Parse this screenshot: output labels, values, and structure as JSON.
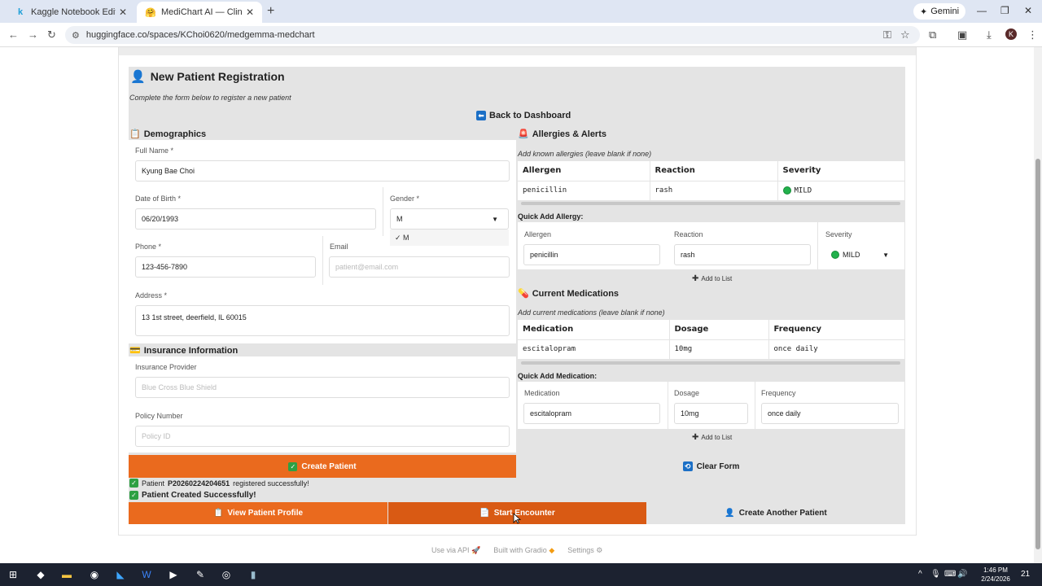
{
  "browser": {
    "tabs": [
      {
        "favicon": "k",
        "title": "Kaggle Notebook Editor"
      },
      {
        "favicon": "hf",
        "title": "MediChart AI — Clinical EHR po"
      }
    ],
    "gemini_label": "Gemini",
    "url": "huggingface.co/spaces/KChoi0620/medgemma-medchart",
    "profile_initial": "K"
  },
  "page": {
    "title": "New Patient Registration",
    "subtitle": "Complete the form below to register a new patient",
    "back_label": "Back to Dashboard"
  },
  "demographics": {
    "title": "Demographics",
    "full_name_label": "Full Name *",
    "full_name_value": "Kyung Bae Choi",
    "dob_label": "Date of Birth *",
    "dob_value": "06/20/1993",
    "gender_label": "Gender *",
    "gender_value": "M",
    "gender_option": "✓ M",
    "phone_label": "Phone *",
    "phone_value": "123-456-7890",
    "email_label": "Email",
    "email_placeholder": "patient@email.com",
    "address_label": "Address *",
    "address_value": "13 1st street, deerfield, IL 60015"
  },
  "insurance": {
    "title": "Insurance Information",
    "provider_label": "Insurance Provider",
    "provider_placeholder": "Blue Cross Blue Shield",
    "policy_label": "Policy Number",
    "policy_placeholder": "Policy ID"
  },
  "allergies": {
    "title": "Allergies & Alerts",
    "subtitle": "Add known allergies (leave blank if none)",
    "columns": [
      "Allergen",
      "Reaction",
      "Severity"
    ],
    "rows": [
      {
        "allergen": "penicillin",
        "reaction": "rash",
        "severity": "MILD"
      }
    ],
    "quick_title": "Quick Add Allergy:",
    "quick_allergen_label": "Allergen",
    "quick_allergen_value": "penicillin",
    "quick_reaction_label": "Reaction",
    "quick_reaction_value": "rash",
    "quick_severity_label": "Severity",
    "quick_severity_value": "MILD",
    "add_label": "Add to List"
  },
  "medications": {
    "title": "Current Medications",
    "subtitle": "Add current medications (leave blank if none)",
    "columns": [
      "Medication",
      "Dosage",
      "Frequency"
    ],
    "rows": [
      {
        "medication": "escitalopram",
        "dosage": "10mg",
        "frequency": "once daily"
      }
    ],
    "quick_title": "Quick Add Medication:",
    "quick_med_label": "Medication",
    "quick_med_value": "escitalopram",
    "quick_dosage_label": "Dosage",
    "quick_dosage_value": "10mg",
    "quick_freq_label": "Frequency",
    "quick_freq_value": "once daily",
    "add_label": "Add to List"
  },
  "actions": {
    "create_label": "Create Patient",
    "clear_label": "Clear Form",
    "msg_prefix": "Patient",
    "patient_id": "P20260224204651",
    "msg_suffix": "registered successfully!",
    "created_label": "Patient Created Successfully!",
    "view_profile_label": "View Patient Profile",
    "start_encounter_label": "Start Encounter",
    "create_another_label": "Create Another Patient"
  },
  "footer": {
    "api": "Use via API",
    "gradio": "Built with Gradio",
    "settings": "Settings"
  },
  "taskbar": {
    "time": "1:46 PM",
    "date": "2/24/2026",
    "notif_count": "21"
  },
  "colors": {
    "accent_orange": "#ea6a1e",
    "success_green": "#2ea043",
    "panel_gray": "#e4e4e4"
  }
}
